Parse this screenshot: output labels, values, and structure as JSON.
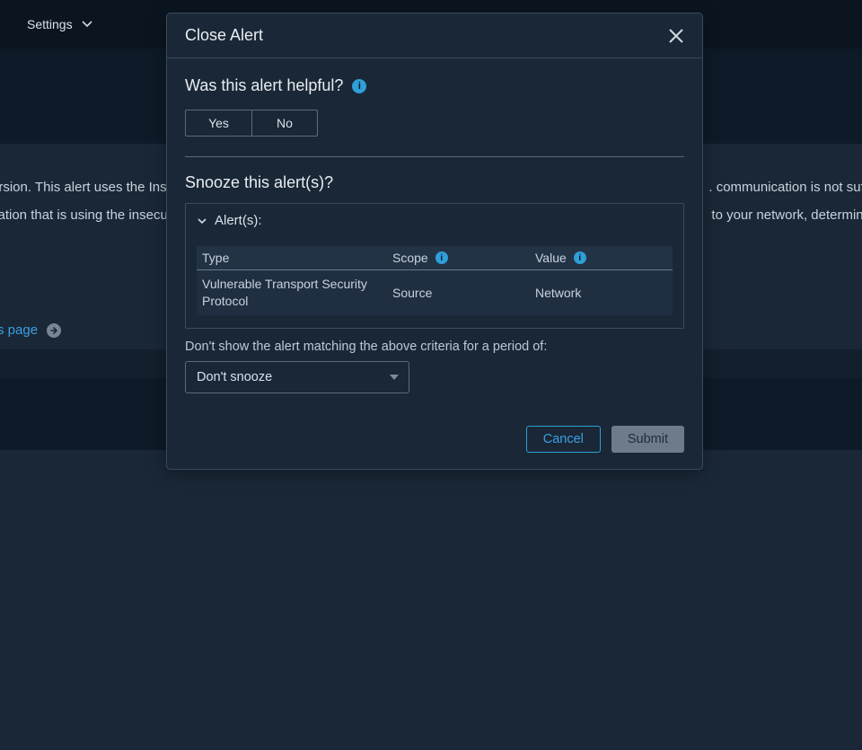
{
  "menubar": {
    "settings": "Settings"
  },
  "background": {
    "line1_left": "ersion. This alert uses the Ins",
    "line1_right": ". communication is not suffi",
    "line2_left": "cation that is using the insecu",
    "line2_right": "to your network, determine",
    "page_link": "s page"
  },
  "modal": {
    "title": "Close Alert",
    "helpful_heading": "Was this alert helpful?",
    "yes": "Yes",
    "no": "No",
    "snooze_heading": "Snooze this alert(s)?",
    "alerts_label": "Alert(s):",
    "table": {
      "headers": {
        "type": "Type",
        "scope": "Scope",
        "value": "Value"
      },
      "rows": [
        {
          "type": "Vulnerable Transport Security Protocol",
          "scope": "Source",
          "value": "Network"
        }
      ]
    },
    "snooze_text": "Don't show the alert matching the above criteria for a period of:",
    "snooze_select": "Don't snooze",
    "cancel": "Cancel",
    "submit": "Submit"
  }
}
